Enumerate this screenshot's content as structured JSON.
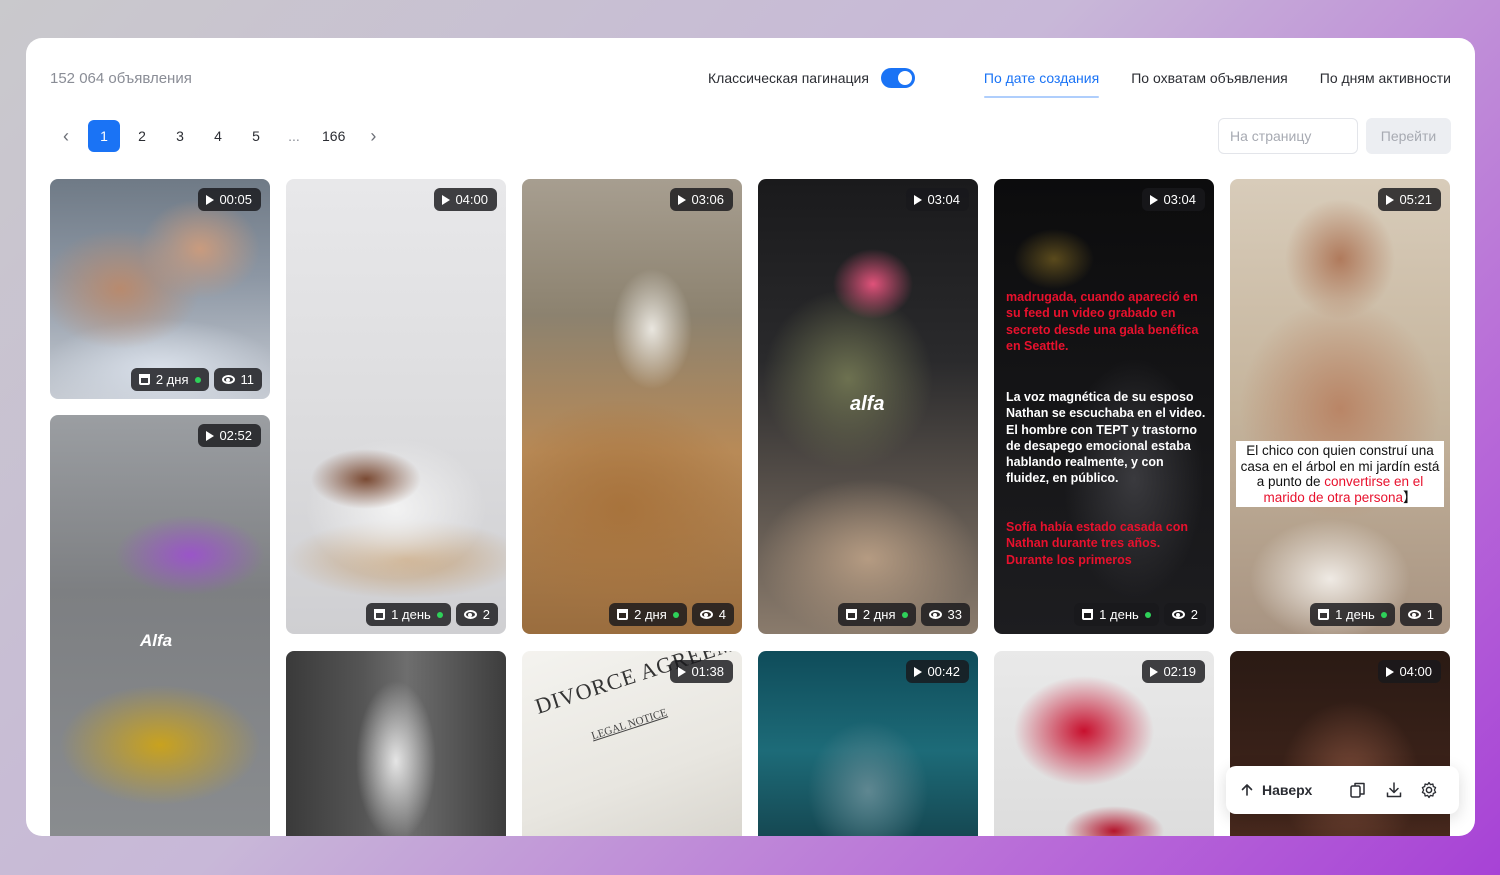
{
  "header": {
    "ads_count": "152 064 объявления",
    "pagination_toggle_label": "Классическая пагинация",
    "pagination_toggle_on": true,
    "sort_tabs": [
      {
        "label": "По дате создания",
        "active": true
      },
      {
        "label": "По охватам объявления",
        "active": false
      },
      {
        "label": "По дням активности",
        "active": false
      }
    ]
  },
  "pagination": {
    "prev_icon": "chevron-left-icon",
    "pages": [
      "1",
      "2",
      "3",
      "4",
      "5"
    ],
    "ellipsis": "...",
    "last_page": "166",
    "current_page": "1",
    "next_icon": "chevron-right-icon",
    "goto_placeholder": "На страницу",
    "goto_button": "Перейти"
  },
  "cards": [
    {
      "duration": "00:05",
      "age": "2 дня",
      "views": "11"
    },
    {
      "duration": "04:00",
      "age": "1 день",
      "views": "2"
    },
    {
      "duration": "03:06",
      "age": "2 дня",
      "views": "4"
    },
    {
      "duration": "03:04",
      "age": "2 дня",
      "views": "33",
      "logo": "alfa"
    },
    {
      "duration": "03:04",
      "age": "1 день",
      "views": "2",
      "text_red_1": "madrugada, cuando apareció en su feed un video grabado en secreto desde una gala benéfica en Seattle.",
      "text_white": "La voz magnética de su esposo Nathan se escuchaba en el video. El hombre con TEPT y trastorno de desapego emocional estaba hablando realmente, y con fluidez, en público.",
      "text_red_2": "Sofía había estado casada con Nathan durante tres años. Durante los primeros"
    },
    {
      "duration": "05:21",
      "age": "1 день",
      "views": "1",
      "caption_black": "El chico con quien construí una casa en el árbol en mi jardín está a punto de ",
      "caption_red": "convertirse en el marido de otra persona",
      "caption_end": "】"
    },
    {
      "duration": "02:52",
      "logo": "Alfa"
    },
    {
      "duration": ""
    },
    {
      "duration": "01:38",
      "doc_title": "DIVORCE AGREEM",
      "doc_sub": "LEGAL NOTICE"
    },
    {
      "duration": "00:42"
    },
    {
      "duration": "02:19"
    },
    {
      "duration": "04:00"
    }
  ],
  "floating_bar": {
    "up_label": "Наверх",
    "up_icon": "arrow-up-icon",
    "icons": [
      "copy-icon",
      "download-icon",
      "settings-icon"
    ]
  },
  "colors": {
    "accent": "#1a73f5",
    "online_dot": "#2ed159",
    "caption_red": "#e8112d"
  }
}
